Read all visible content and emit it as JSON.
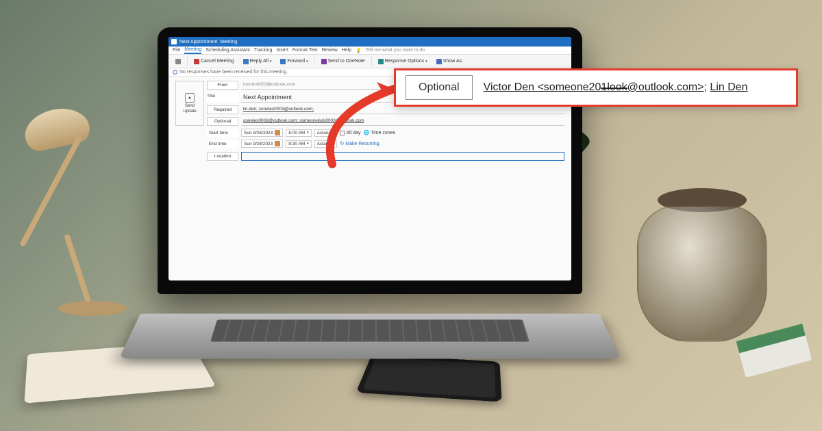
{
  "window": {
    "title_prefix": "Next Appointment",
    "title_suffix": "Meeting"
  },
  "tabs": {
    "file": "File",
    "meeting": "Meeting",
    "scheduling": "Scheduling Assistant",
    "tracking": "Tracking",
    "insert": "Insert",
    "format": "Format Text",
    "review": "Review",
    "help": "Help",
    "tell_me": "Tell me what you want to do"
  },
  "ribbon": {
    "cancel": "Cancel Meeting",
    "reply_all": "Reply All",
    "forward": "Forward",
    "onenote": "Send to OneNote",
    "response": "Response Options",
    "show_as": "Show As:"
  },
  "info_bar": "No responses have been received for this meeting.",
  "send": {
    "label": "Send",
    "sublabel": "Update"
  },
  "fields": {
    "from_label": "From",
    "from_value": "mondo0003@outlook.com",
    "title_label": "Title",
    "title_value": "Next Appointment",
    "required_label": "Required",
    "required_value": "lin.den; conelex0003@outlook.com;",
    "optional_label": "Optional",
    "optional_value": "conelex0003@outlook.com; someonelock0003@outlook.com",
    "start_label": "Start time",
    "start_date": "Sun 9/28/2023",
    "start_time": "8:00 AM",
    "start_tz": "Astana",
    "end_label": "End time",
    "end_date": "Sun 9/28/2023",
    "end_time": "8:30 AM",
    "end_tz": "Astana",
    "allday": "All day",
    "timezones": "Time zones",
    "recurring": "Make Recurring",
    "location_label": "Location",
    "location_value": ""
  },
  "callout": {
    "button": "Optional",
    "attendee1_name": "Victor Den",
    "attendee1_email_pre": "<someone20",
    "attendee1_email_strike": "1look",
    "attendee1_email_post": "@outlook.com>",
    "sep": "; ",
    "attendee2": "Lin Den"
  }
}
